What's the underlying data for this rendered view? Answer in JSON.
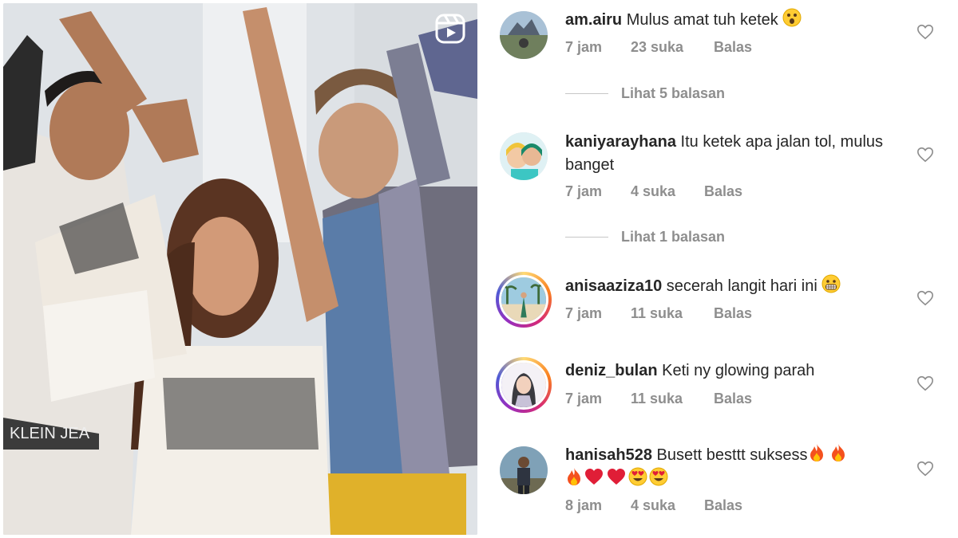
{
  "comments": [
    {
      "username": "am.airu",
      "text": "Mulus amat tuh ketek",
      "emoji": [
        "astonished"
      ],
      "time": "7 jam",
      "likes": "23 suka",
      "reply": "Balas",
      "view_replies": "Lihat 5 balasan"
    },
    {
      "username": "kaniyarayhana",
      "text": "Itu ketek apa jalan tol, mulus banget",
      "emoji": [],
      "time": "7 jam",
      "likes": "4 suka",
      "reply": "Balas",
      "view_replies": "Lihat 1 balasan"
    },
    {
      "username": "anisaaziza10",
      "text": "secerah langit hari ini",
      "emoji": [
        "grimacing"
      ],
      "time": "7 jam",
      "likes": "11 suka",
      "reply": "Balas"
    },
    {
      "username": "deniz_bulan",
      "text": "Keti ny glowing parah",
      "emoji": [],
      "time": "7 jam",
      "likes": "11 suka",
      "reply": "Balas"
    },
    {
      "username": "hanisah528",
      "text": "Busett besttt suksess",
      "emoji": [
        "fire",
        "fire",
        "fire",
        "red-heart",
        "red-heart",
        "heart-eyes",
        "heart-eyes"
      ],
      "time": "8 jam",
      "likes": "4 suka",
      "reply": "Balas"
    }
  ],
  "icons": {
    "reels": "reels-icon",
    "like": "heart-outline-icon"
  },
  "colors": {
    "muted_text": "#8e8e8e",
    "primary_text": "#262626",
    "story_ring": "#d62976"
  }
}
